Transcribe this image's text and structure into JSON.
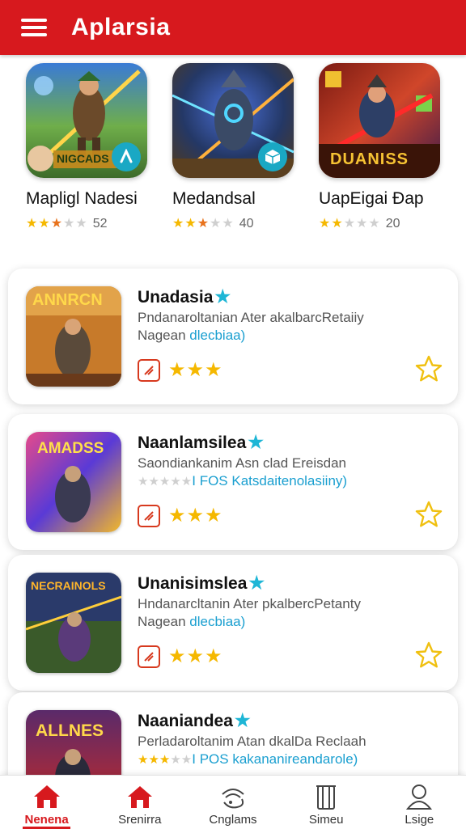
{
  "app": {
    "title": "Aplarsia",
    "accent": "#d7191e"
  },
  "featured": [
    {
      "name": "Mapligl Nadesi",
      "count": "52",
      "rating": 3,
      "thumb_caption": "NIGCADS",
      "badge_icon": "app-store-icon"
    },
    {
      "name": "Medandsal",
      "count": "40",
      "rating": 2.5,
      "thumb_caption": "",
      "badge_icon": "cube-icon"
    },
    {
      "name": "UapEigai Ðap",
      "count": "20",
      "rating": 2,
      "thumb_caption": "DUANISS",
      "badge_icon": ""
    }
  ],
  "list": [
    {
      "title": "Unadasia",
      "desc_line1": "Pndanaroltanian Ater akalbarcRetaiiy",
      "desc_plain": "Nagean ",
      "desc_accent": "dlecbiaa)",
      "thumb_caption": "ANNRCN",
      "stars": "★★★"
    },
    {
      "title": "Naanlamsilea",
      "desc_line1": "Saondiankanim Asn clad Ereisdan",
      "desc_plain": "",
      "desc_accent": "I FOS Katsdaitenolasiiny)",
      "thumb_caption": "AMADSS",
      "stars": "★★★"
    },
    {
      "title": "Unanisimslea",
      "desc_line1": "Hndanarcltanin Ater pkalbercPetanty",
      "desc_plain": "Nagean ",
      "desc_accent": "dlecbiaa)",
      "thumb_caption": "NECRAINOLS",
      "stars": "★★★"
    },
    {
      "title": "Naaniandea",
      "desc_line1": "Perladaroltanim Atan dkalDa Reclaah",
      "desc_plain": "",
      "desc_accent": "I POS kakananireandarole)",
      "thumb_caption": "ALLNES",
      "stars": "★★★"
    }
  ],
  "nav": [
    {
      "label": "Nenena",
      "icon": "home-icon",
      "active": true
    },
    {
      "label": "Srenirra",
      "icon": "store-icon",
      "active": false
    },
    {
      "label": "Cnglams",
      "icon": "controller-icon",
      "active": false
    },
    {
      "label": "Simeu",
      "icon": "library-icon",
      "active": false
    },
    {
      "label": "Lsige",
      "icon": "profile-icon",
      "active": false
    }
  ]
}
